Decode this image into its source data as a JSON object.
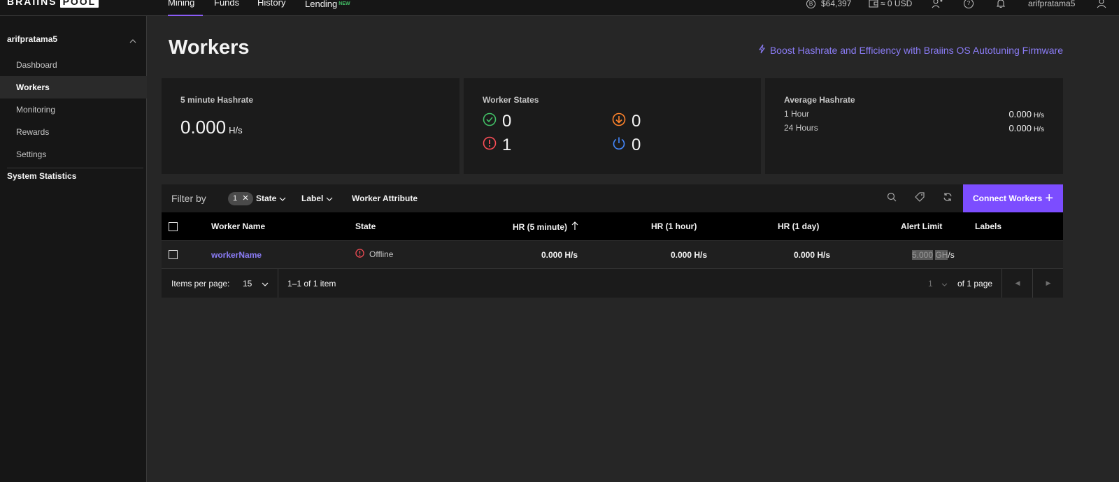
{
  "brand": {
    "left": "BRAIINS",
    "right": "POOL"
  },
  "nav": {
    "tabs": [
      {
        "label": "Mining"
      },
      {
        "label": "Funds"
      },
      {
        "label": "History"
      },
      {
        "label": "Lending",
        "badge": "NEW"
      }
    ],
    "btc_price": "$64,397",
    "wallet": "≈ 0 USD",
    "username": "arifpratama5"
  },
  "sidebar": {
    "account": "arifpratama5",
    "items": [
      {
        "label": "Dashboard"
      },
      {
        "label": "Workers"
      },
      {
        "label": "Monitoring"
      },
      {
        "label": "Rewards"
      },
      {
        "label": "Settings"
      }
    ],
    "section": "System Statistics"
  },
  "page": {
    "title": "Workers",
    "boost_link": "Boost Hashrate and Efficiency with Braiins OS Autotuning Firmware"
  },
  "cards": {
    "hashrate5": {
      "label": "5 minute Hashrate",
      "value": "0.000",
      "unit": "H/s"
    },
    "states": {
      "label": "Worker States",
      "ok": "0",
      "low": "0",
      "offline": "1",
      "disabled": "0"
    },
    "avg": {
      "label": "Average Hashrate",
      "rows": [
        {
          "period": "1 Hour",
          "value": "0.000",
          "unit": "H/s"
        },
        {
          "period": "24 Hours",
          "value": "0.000",
          "unit": "H/s"
        }
      ]
    }
  },
  "filter": {
    "label": "Filter by",
    "chip_count": "1",
    "state": "State",
    "label_dd": "Label",
    "attribute": "Worker Attribute",
    "connect": "Connect Workers"
  },
  "table": {
    "headers": {
      "name": "Worker Name",
      "state": "State",
      "hr5": "HR (5 minute)",
      "hr1h": "HR (1 hour)",
      "hr1d": "HR (1 day)",
      "alert": "Alert Limit",
      "labels": "Labels"
    },
    "rows": [
      {
        "name": "workerName",
        "state": "Offline",
        "hr5": "0.000",
        "hr1h": "0.000",
        "hr1d": "0.000",
        "unit": "H/s",
        "alert_value": "5.000",
        "alert_prefix": "GH",
        "alert_suffix": "/s"
      }
    ]
  },
  "pagination": {
    "items_label": "Items per page:",
    "per_page": "15",
    "range": "1–1 of 1 item",
    "page": "1",
    "of_pages": "of 1 page"
  },
  "colors": {
    "accent": "#7c4dff",
    "link": "#8b7cf6",
    "ok": "#42be65",
    "warn": "#ff832b",
    "error": "#fa4d56",
    "info": "#4589ff"
  }
}
